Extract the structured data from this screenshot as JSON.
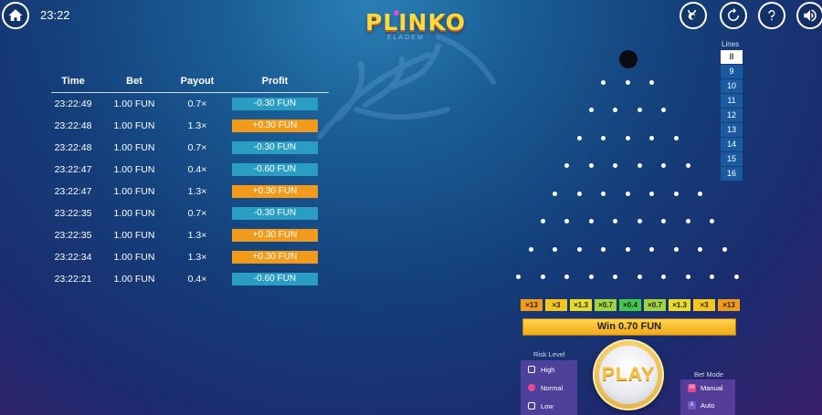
{
  "header": {
    "time": "23:22",
    "logo": "PLINKO",
    "logo_sub": "ELADEM",
    "icons": [
      "home-icon",
      "horoscope-icon",
      "refresh-icon",
      "help-icon",
      "sound-icon"
    ]
  },
  "history": {
    "columns": [
      "Time",
      "Bet",
      "Payout",
      "Profit"
    ],
    "rows": [
      {
        "time": "23:22:49",
        "bet": "1.00 FUN",
        "payout": "0.7×",
        "profit": "-0.30 FUN",
        "type": "neg"
      },
      {
        "time": "23:22:48",
        "bet": "1.00 FUN",
        "payout": "1.3×",
        "profit": "+0.30 FUN",
        "type": "pos"
      },
      {
        "time": "23:22:48",
        "bet": "1.00 FUN",
        "payout": "0.7×",
        "profit": "-0.30 FUN",
        "type": "neg"
      },
      {
        "time": "23:22:47",
        "bet": "1.00 FUN",
        "payout": "0.4×",
        "profit": "-0.60 FUN",
        "type": "neg"
      },
      {
        "time": "23:22:47",
        "bet": "1.00 FUN",
        "payout": "1.3×",
        "profit": "+0.30 FUN",
        "type": "pos"
      },
      {
        "time": "23:22:35",
        "bet": "1.00 FUN",
        "payout": "0.7×",
        "profit": "-0.30 FUN",
        "type": "neg"
      },
      {
        "time": "23:22:35",
        "bet": "1.00 FUN",
        "payout": "1.3×",
        "profit": "+0.30 FUN",
        "type": "pos"
      },
      {
        "time": "23:22:34",
        "bet": "1.00 FUN",
        "payout": "1.3×",
        "profit": "+0.30 FUN",
        "type": "pos"
      },
      {
        "time": "23:22:21",
        "bet": "1.00 FUN",
        "payout": "0.4×",
        "profit": "-0.60 FUN",
        "type": "neg"
      }
    ]
  },
  "lines": {
    "title": "Lines",
    "options": [
      "8",
      "9",
      "10",
      "11",
      "12",
      "13",
      "14",
      "15",
      "16"
    ],
    "selected": "8"
  },
  "board": {
    "rows": 8
  },
  "buckets": [
    {
      "label": "×13",
      "color": "#f29b1a"
    },
    {
      "label": "×3",
      "color": "#f6c61e"
    },
    {
      "label": "×1.3",
      "color": "#e8dc2a"
    },
    {
      "label": "×0.7",
      "color": "#9fd43a"
    },
    {
      "label": "×0.4",
      "color": "#42c84a"
    },
    {
      "label": "×0.7",
      "color": "#9fd43a"
    },
    {
      "label": "×1.3",
      "color": "#e8dc2a"
    },
    {
      "label": "×3",
      "color": "#f6c61e"
    },
    {
      "label": "×13",
      "color": "#f29b1a"
    }
  ],
  "win_banner": "Win 0.70 FUN",
  "risk": {
    "title": "Risk Level",
    "options": [
      "High",
      "Normal",
      "Low"
    ],
    "selected": "Normal"
  },
  "play_label": "PLAY",
  "bet_mode": {
    "title": "Bet Mode",
    "options": [
      {
        "label": "Manual",
        "key": "M"
      },
      {
        "label": "Auto",
        "key": "A"
      }
    ],
    "selected": "Manual"
  }
}
